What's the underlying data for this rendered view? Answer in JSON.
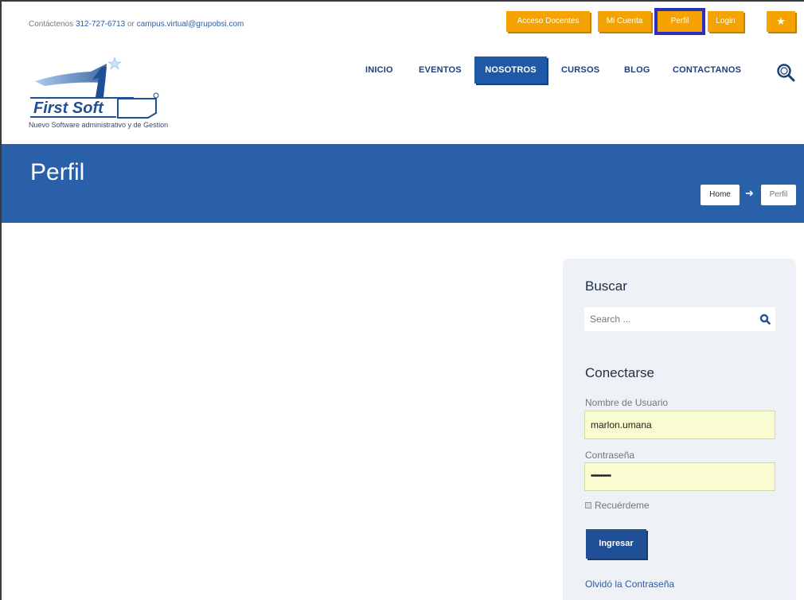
{
  "header": {
    "contact_prefix": "Contáctenos",
    "phone": "312-727-6713",
    "or_text": "or",
    "email": "campus.virtual@grupobsi.com",
    "top_buttons": [
      "Acceso Docentes",
      "Mi Cuenta",
      "Perfil",
      "Login"
    ],
    "star_icon": "star-icon"
  },
  "brand": {
    "logo_text": "First Soft",
    "tagline": "Nuevo Software administrativo y de Gestion"
  },
  "nav": {
    "items": [
      "INICIO",
      "EVENTOS",
      "NOSOTROS",
      "CURSOS",
      "BLOG",
      "CONTACTANOS"
    ],
    "active": "NOSOTROS"
  },
  "banner": {
    "title": "Perfil",
    "breadcrumb": [
      "Home",
      "Perfil"
    ]
  },
  "sidebar": {
    "search_heading": "Buscar",
    "search_placeholder": "Search ...",
    "login_heading": "Conectarse",
    "username_label": "Nombre de Usuario",
    "username_value": "marlon.umana",
    "password_label": "Contraseña",
    "password_value": "••••••••••",
    "remember_label": "Recuérdeme",
    "submit_label": "Ingresar",
    "forgot_label": "Olvidó la Contraseña"
  },
  "colors": {
    "accent_orange": "#f5a300",
    "brand_blue": "#2a5faa",
    "highlight": "#2b2fb9"
  }
}
